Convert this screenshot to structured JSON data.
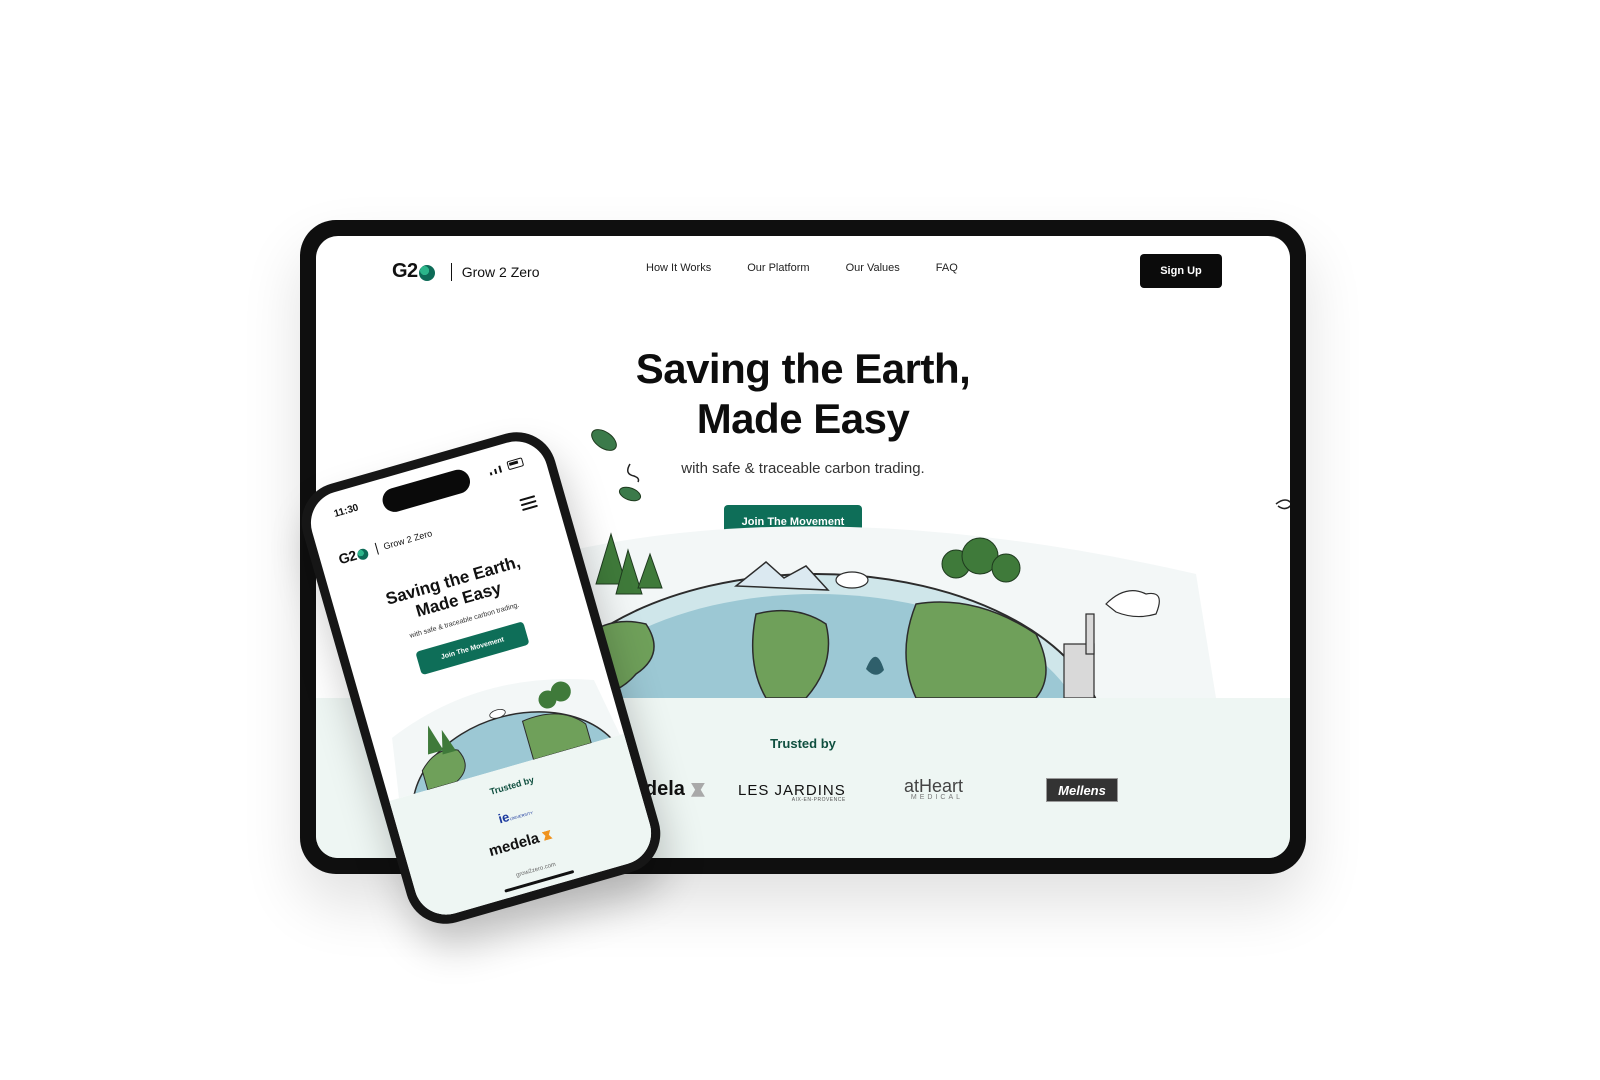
{
  "brand": {
    "mark": "G2",
    "name": "Grow 2 Zero"
  },
  "nav": {
    "links": [
      "How It Works",
      "Our Platform",
      "Our Values",
      "FAQ"
    ],
    "signup_label": "Sign Up"
  },
  "hero": {
    "title_line1": "Saving the Earth,",
    "title_line2": "Made Easy",
    "subtitle": "with safe & traceable carbon trading.",
    "cta_label": "Join The Movement"
  },
  "trusted": {
    "title": "Trusted by",
    "logos": {
      "medela": "medela",
      "jardins": "LES JARDINS",
      "jardins_sub": "AIX-EN-PROVENCE",
      "atheart": "atHeart",
      "atheart_sub": "MEDICAL",
      "mellens": "Mellens"
    }
  },
  "phone": {
    "time": "11:30",
    "title_line1": "Saving the Earth,",
    "title_line2": "Made Easy",
    "subtitle": "with safe & traceable carbon trading.",
    "cta_label": "Join The Movement",
    "trusted_title": "Trusted by",
    "ie_logo": "ie",
    "ie_sub": "UNIVERSITY",
    "medela_logo": "medela",
    "url": "grow2zero.com"
  },
  "colors": {
    "accent": "#0e6e58",
    "trusted_bg": "#eef6f3",
    "frame": "#0f0f0f"
  },
  "icons": [
    "globe-icon",
    "menu-icon",
    "signal-icon",
    "battery-icon"
  ]
}
